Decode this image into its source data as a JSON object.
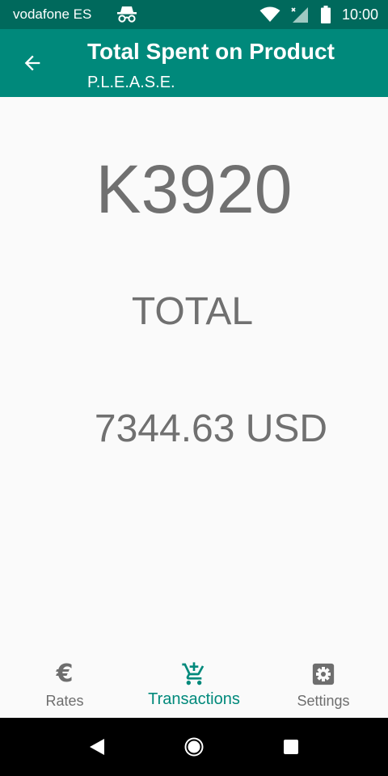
{
  "status_bar": {
    "carrier": "vodafone ES",
    "time": "10:00",
    "icons": [
      "incognito-icon",
      "wifi-icon",
      "signal-no-data-icon",
      "battery-icon"
    ]
  },
  "app_bar": {
    "back_icon": "arrow-left-icon",
    "title": "Total Spent on Product",
    "subtitle": "P.L.E.A.S.E."
  },
  "main": {
    "product_code": "K3920",
    "total_label": "TOTAL",
    "total_amount": "7344.63 USD"
  },
  "bottom_nav": {
    "items": [
      {
        "label": "Rates",
        "icon": "euro-icon",
        "active": false
      },
      {
        "label": "Transactions",
        "icon": "cart-add-icon",
        "active": true
      },
      {
        "label": "Settings",
        "icon": "gear-icon",
        "active": false
      }
    ],
    "euro_symbol": "€"
  },
  "system_nav": {
    "icons": [
      "back-triangle-icon",
      "home-circle-icon",
      "recents-square-icon"
    ]
  },
  "colors": {
    "status_bar": "#00695c",
    "app_bar": "#00897b",
    "accent": "#00897b",
    "text_main": "#707070",
    "background": "#fafafa",
    "system_nav": "#000000"
  }
}
